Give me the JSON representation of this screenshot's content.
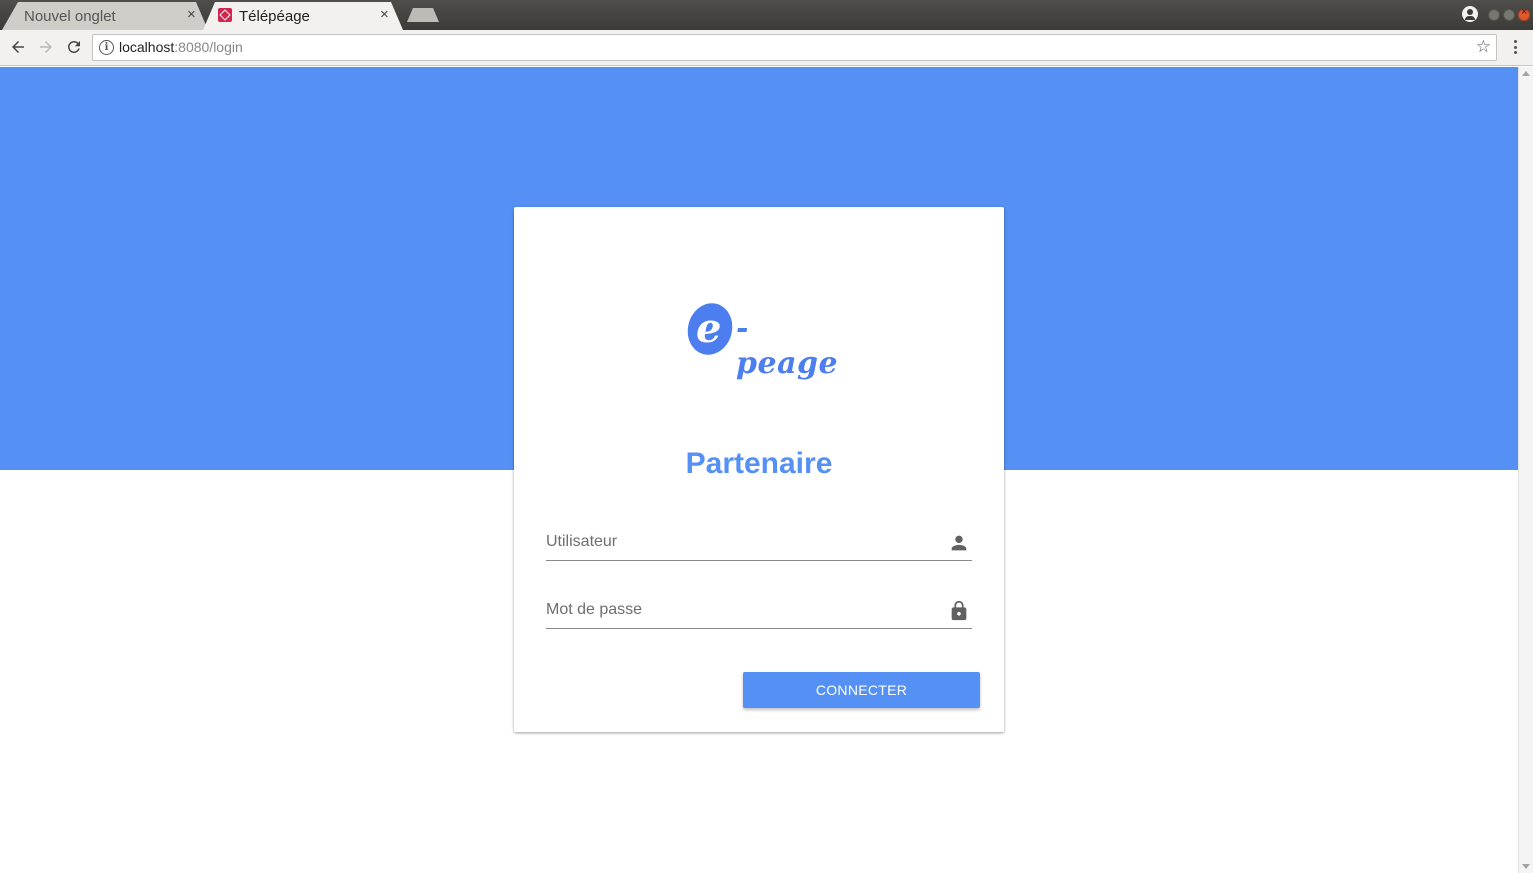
{
  "browser": {
    "tabs": [
      {
        "title": "Nouvel onglet",
        "active": false
      },
      {
        "title": "Télépéage",
        "active": true
      }
    ],
    "tab_close_glyph": "×",
    "url_host": "localhost",
    "url_rest": ":8080/login",
    "icons": {
      "back": "arrow-left-icon",
      "forward": "arrow-right-icon",
      "reload": "reload-icon",
      "info": "info-icon",
      "bookmark": "star-icon",
      "menu": "kebab-menu-icon"
    }
  },
  "login": {
    "logo_letter": "e",
    "logo_text": "-peage",
    "title": "Partenaire",
    "username_placeholder": "Utilisateur",
    "password_placeholder": "Mot de passe",
    "username_icon": "person-icon",
    "password_icon": "lock-icon",
    "submit_label": "CONNECTER"
  },
  "colors": {
    "brand": "#5591f4",
    "logo": "#4d7ef0",
    "background": "#ffffff"
  }
}
